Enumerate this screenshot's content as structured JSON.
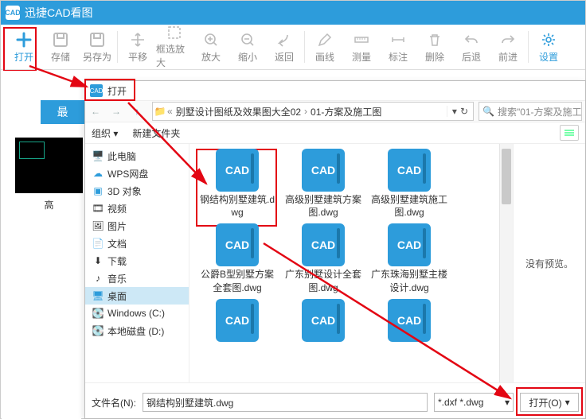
{
  "app_title": "迅捷CAD看图",
  "toolbar": [
    "打开",
    "存储",
    "另存为",
    "平移",
    "框选放大",
    "放大",
    "缩小",
    "返回",
    "画线",
    "测量",
    "标注",
    "删除",
    "后退",
    "前进",
    "设置"
  ],
  "side": {
    "tab": "最",
    "thumb": "高"
  },
  "dialog": {
    "title": "打开",
    "path": [
      "别墅设计图纸及效果图大全02",
      "01-方案及施工图"
    ],
    "search_placeholder": "搜索\"01-方案及施工",
    "organize": "组织 ▾",
    "newfolder": "新建文件夹",
    "nopreview": "没有预览。",
    "filename_label": "文件名(N):",
    "filename_value": "钢结构别墅建筑.dwg",
    "filetype": "*.dxf *.dwg",
    "open_btn": "打开(O)"
  },
  "tree": [
    "此电脑",
    "WPS网盘",
    "3D 对象",
    "视频",
    "图片",
    "文档",
    "下载",
    "音乐",
    "桌面",
    "Windows (C:)",
    "本地磁盘 (D:)"
  ],
  "files": [
    "钢结构别墅建筑.dwg",
    "高级别墅建筑方案图.dwg",
    "高级别墅建筑施工图.dwg",
    "公爵B型别墅方案全套图.dwg",
    "广东别墅设计全套图.dwg",
    "广东珠海别墅主楼设计.dwg"
  ]
}
